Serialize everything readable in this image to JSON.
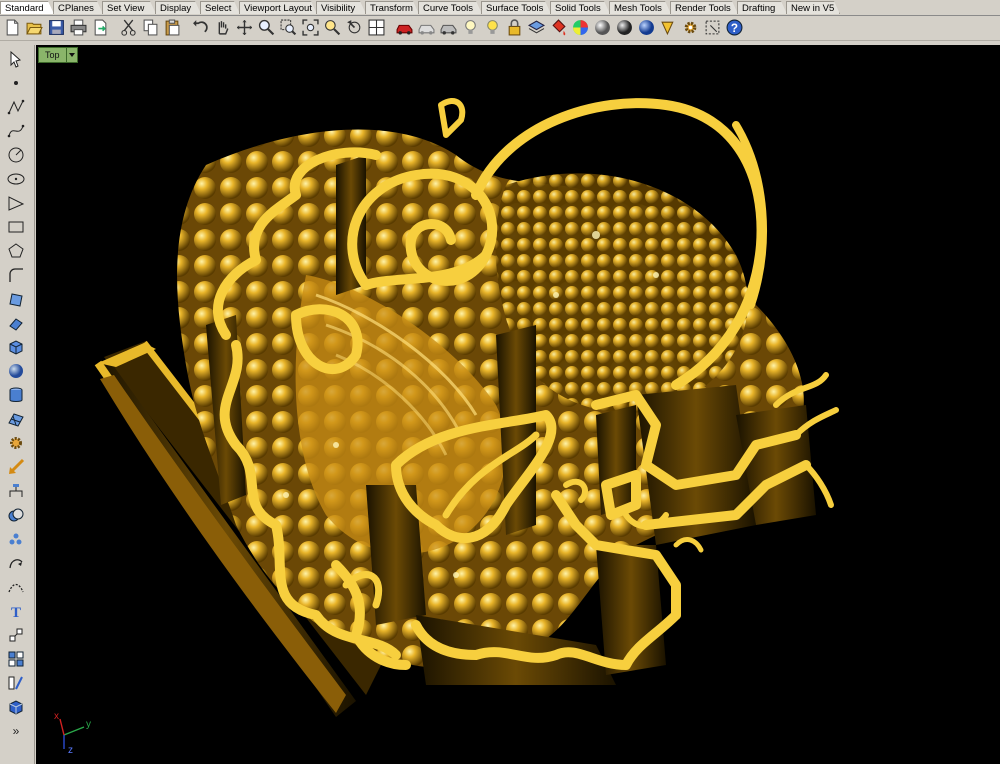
{
  "tabs": [
    {
      "label": "Standard",
      "active": true
    },
    {
      "label": "CPlanes"
    },
    {
      "label": "Set View"
    },
    {
      "label": "Display"
    },
    {
      "label": "Select"
    },
    {
      "label": "Viewport Layout"
    },
    {
      "label": "Visibility"
    },
    {
      "label": "Transform"
    },
    {
      "label": "Curve Tools"
    },
    {
      "label": "Surface Tools"
    },
    {
      "label": "Solid Tools"
    },
    {
      "label": "Mesh Tools"
    },
    {
      "label": "Render Tools"
    },
    {
      "label": "Drafting"
    },
    {
      "label": "New in V5"
    }
  ],
  "viewport": {
    "title": "Top"
  },
  "axes": {
    "x_label": "x",
    "y_label": "y",
    "z_label": "z"
  },
  "colors": {
    "background": "#000000",
    "model_gold": "#e8b92a",
    "model_rim": "#f7cf3e",
    "model_shadow": "#4a3300",
    "ui_face": "#d4d0c8",
    "viewport_tab": "#8ab56a"
  }
}
